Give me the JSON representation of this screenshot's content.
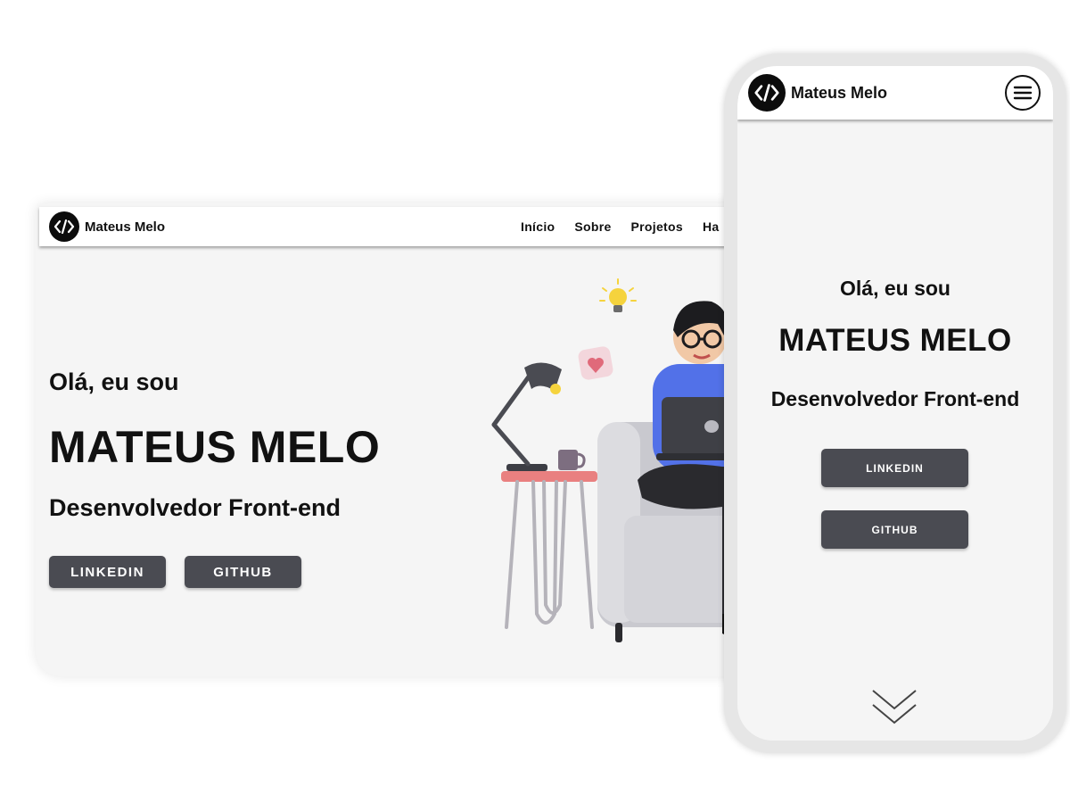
{
  "brand": {
    "name": "Mateus Melo"
  },
  "desktop": {
    "nav": [
      "Início",
      "Sobre",
      "Projetos",
      "Ha"
    ],
    "hero": {
      "greeting": "Olá, eu sou",
      "name": "MATEUS MELO",
      "role": "Desenvolvedor Front-end",
      "linkedin": "LINKEDIN",
      "github": "GITHUB"
    }
  },
  "mobile": {
    "hero": {
      "greeting": "Olá, eu sou",
      "name": "MATEUS MELO",
      "role": "Desenvolvedor Front-end",
      "linkedin": "LINKEDIN",
      "github": "GITHUB"
    }
  },
  "icons": {
    "logo": "code-brackets-icon",
    "menu": "hamburger-menu-icon",
    "scroll": "double-chevron-down-icon"
  },
  "colors": {
    "button": "#4a4b52",
    "logo_bg": "#0c0c0c",
    "hero_bg": "#f5f5f5"
  }
}
